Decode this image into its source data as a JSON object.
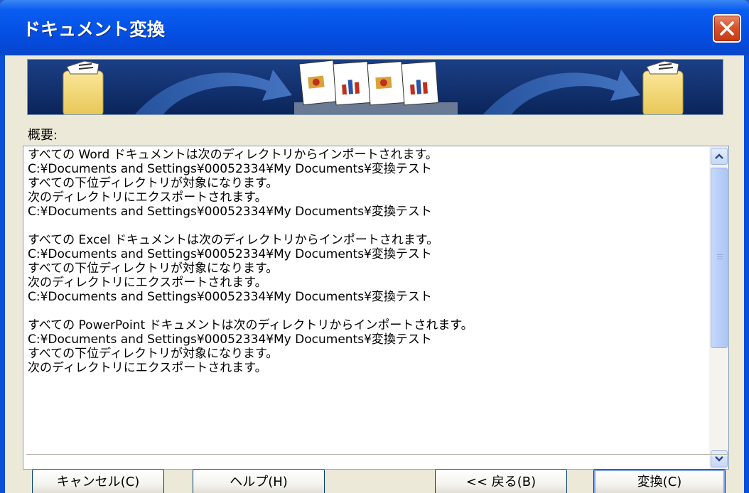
{
  "window": {
    "title": "ドキュメント変換"
  },
  "summary": {
    "label": "概要:",
    "lines": [
      "すべての Word ドキュメントは次のディレクトリからインポートされます。",
      "C:¥Documents and Settings¥00052334¥My Documents¥変換テスト",
      "すべての下位ディレクトリが対象になります。",
      "次のディレクトリにエクスポートされます。",
      "C:¥Documents and Settings¥00052334¥My Documents¥変換テスト",
      "",
      "すべての Excel ドキュメントは次のディレクトリからインポートされます。",
      "C:¥Documents and Settings¥00052334¥My Documents¥変換テスト",
      "すべての下位ディレクトリが対象になります。",
      "次のディレクトリにエクスポートされます。",
      "C:¥Documents and Settings¥00052334¥My Documents¥変換テスト",
      "",
      "すべての PowerPoint ドキュメントは次のディレクトリからインポートされます。",
      "C:¥Documents and Settings¥00052334¥My Documents¥変換テスト",
      "すべての下位ディレクトリが対象になります。",
      "次のディレクトリにエクスポートされます。"
    ]
  },
  "buttons": {
    "cancel": "キャンセル(C)",
    "help": "ヘルプ(H)",
    "back": "<< 戻る(B)",
    "convert": "変換(C)"
  },
  "colors": {
    "titlebar": "#0551e6",
    "dialog_bg": "#ece9d8",
    "banner_bg": "#0a2a6a",
    "close_button": "#d8532c"
  }
}
